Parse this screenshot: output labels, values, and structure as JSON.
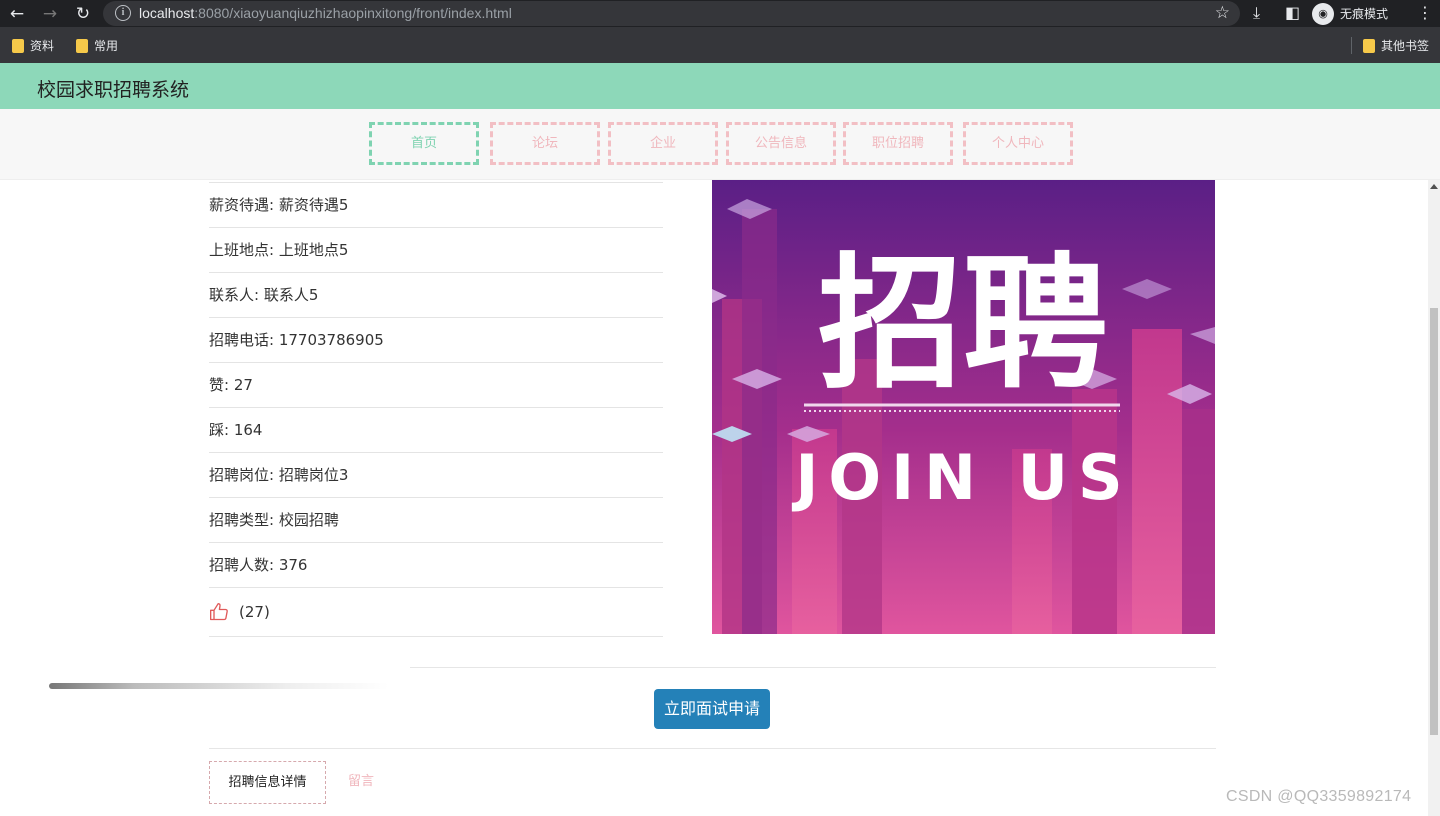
{
  "browser": {
    "url_host": "localhost",
    "url_path": ":8080/xiaoyuanqiuzhizhaopinxitong/front/index.html",
    "incognito_label": "无痕模式",
    "bookmarks": [
      "资料",
      "常用"
    ],
    "other_bookmarks": "其他书签"
  },
  "site": {
    "title": "校园求职招聘系统",
    "nav": [
      "首页",
      "论坛",
      "企业",
      "公告信息",
      "职位招聘",
      "个人中心"
    ],
    "active_nav": "首页"
  },
  "details": {
    "rows": [
      "薪资待遇: 薪资待遇5",
      "上班地点: 上班地点5",
      "联系人: 联系人5",
      "招聘电话: 17703786905",
      "赞: 27",
      "踩: 164",
      "招聘岗位: 招聘岗位3",
      "招聘类型: 校园招聘",
      "招聘人数: 376"
    ],
    "like_count": "(27)"
  },
  "poster": {
    "headline": "招聘",
    "subline": "JOIN US"
  },
  "actions": {
    "apply_label": "立即面试申请"
  },
  "tabs": {
    "detail_label": "招聘信息详情",
    "comment_label": "留言"
  },
  "watermark": "CSDN @QQ3359892174",
  "colors": {
    "header_bg": "#8dd8b9",
    "nav_active": "#7fd3b1",
    "nav_inactive": "#f0b7bd",
    "apply_button": "#2481b8"
  }
}
